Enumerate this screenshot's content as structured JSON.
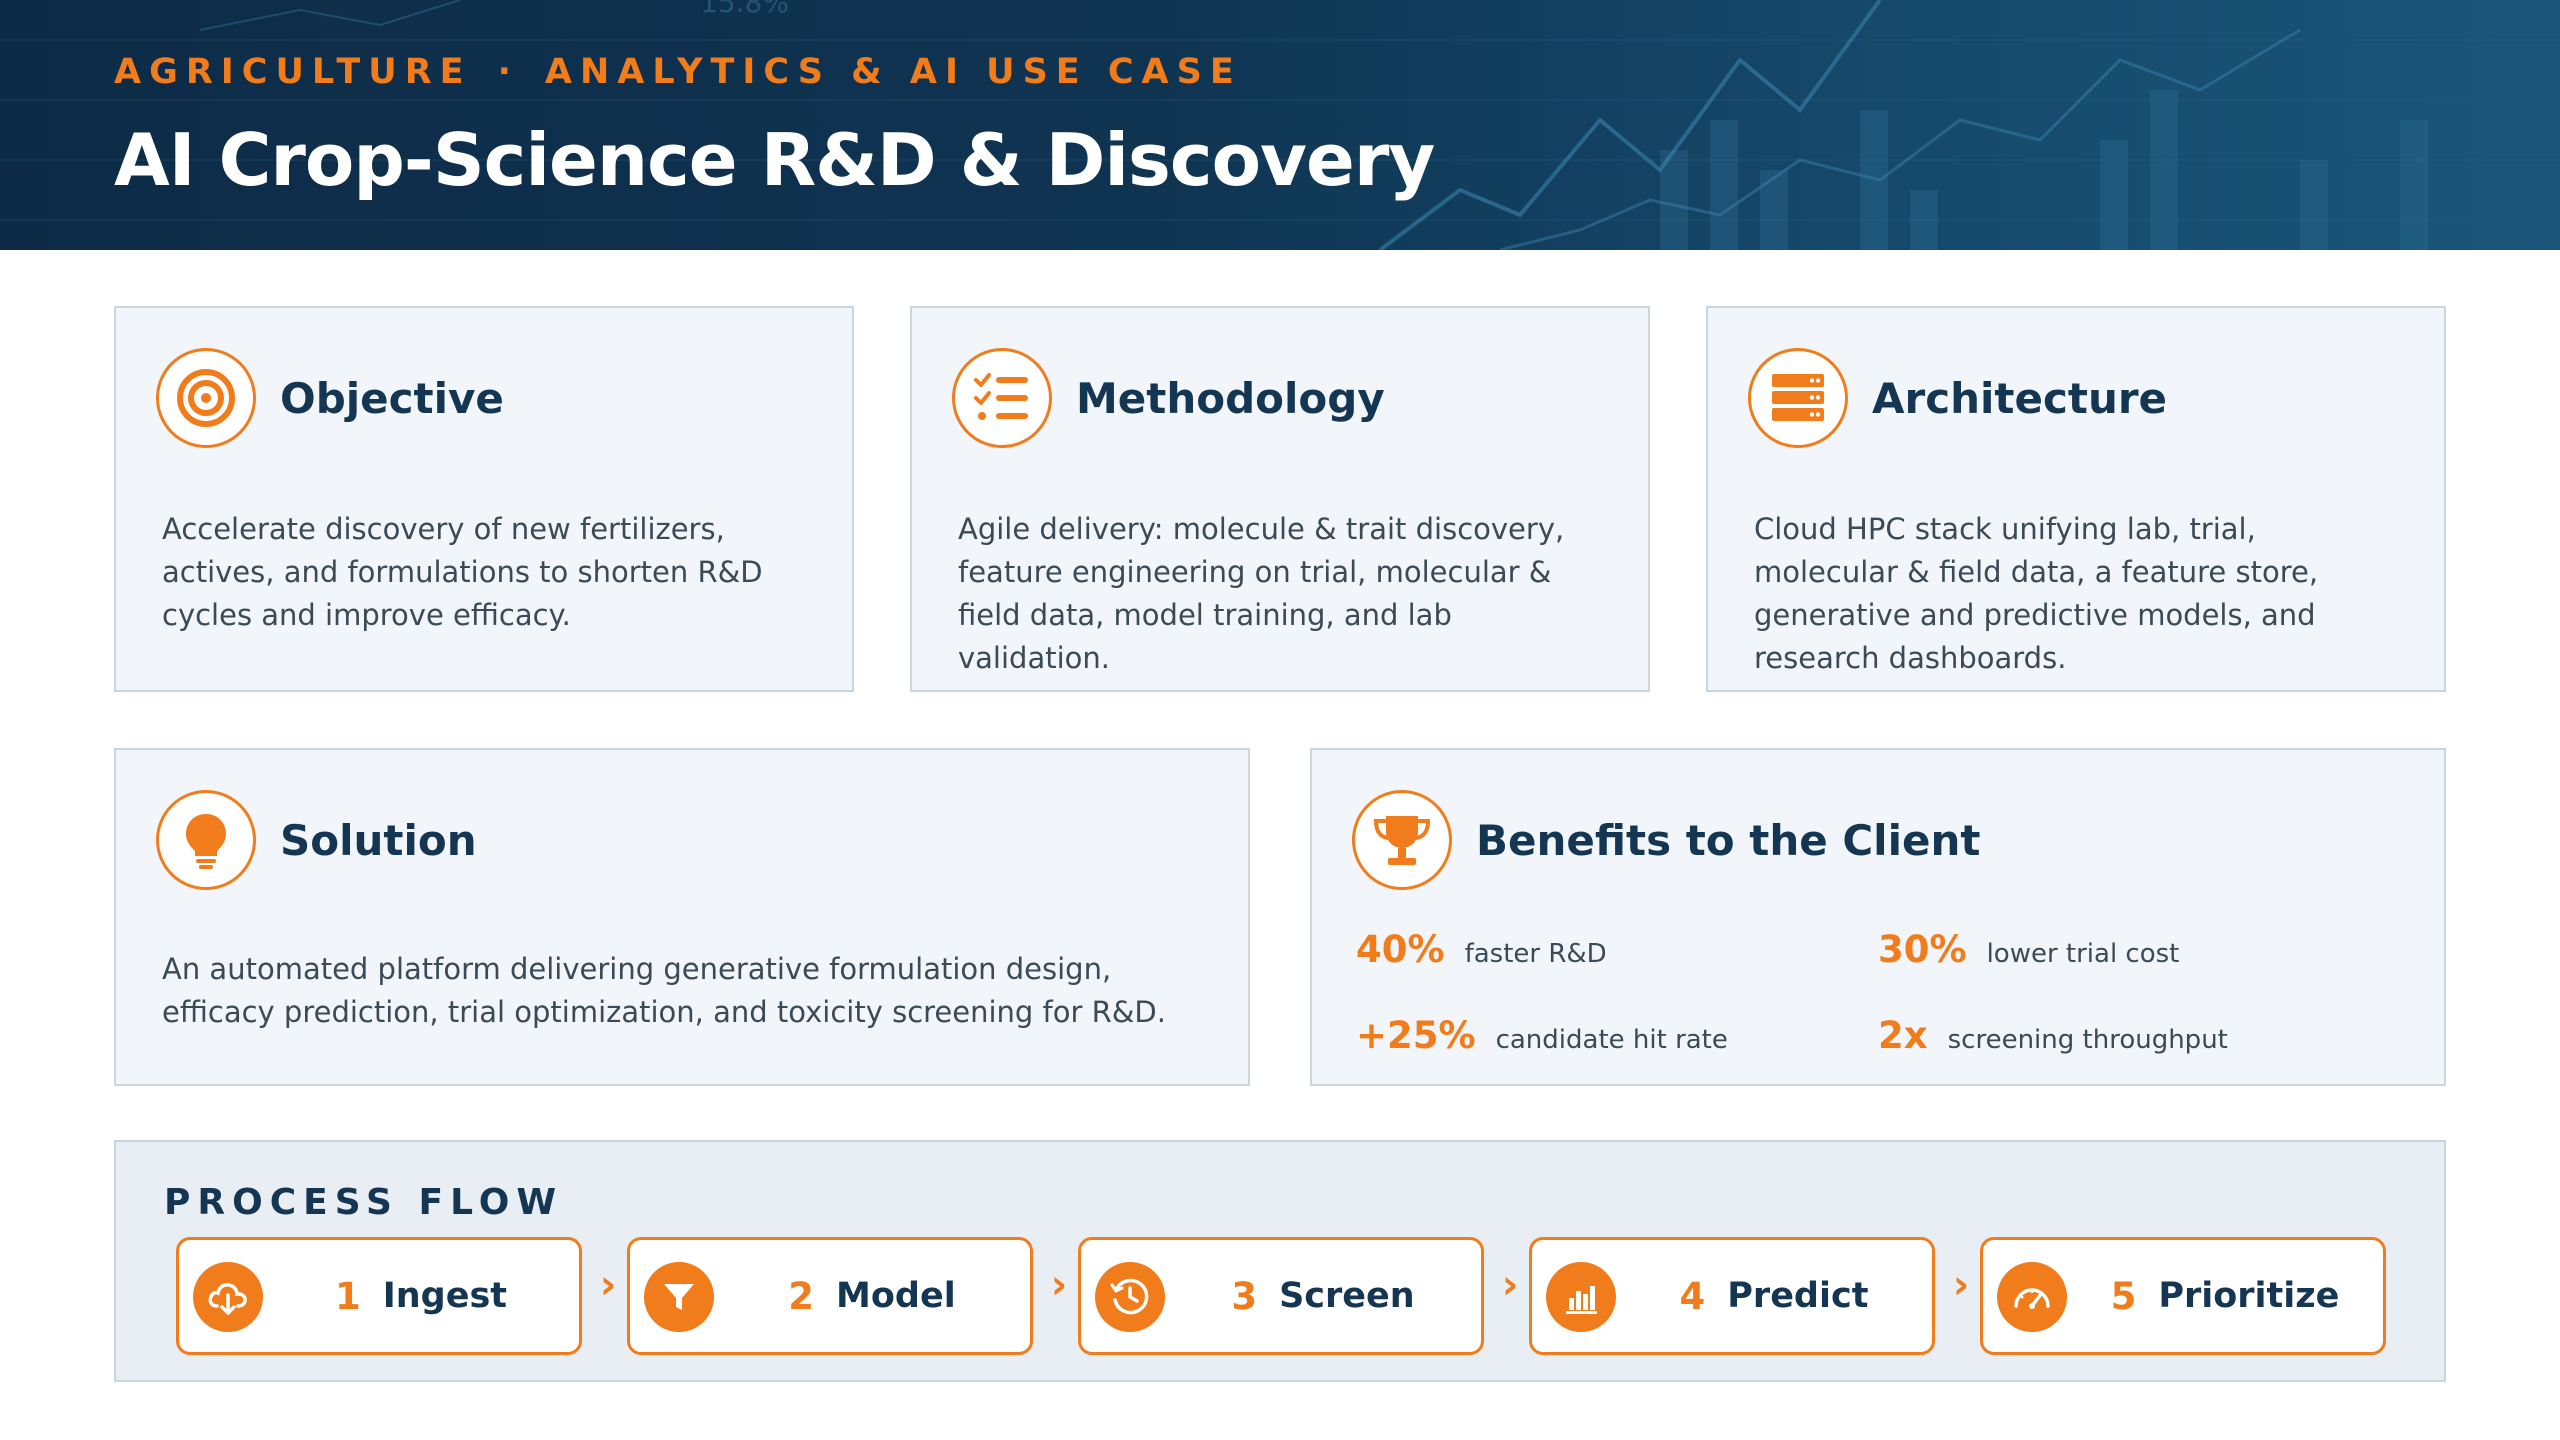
{
  "header": {
    "eyebrow_left": "AGRICULTURE",
    "eyebrow_sep": "·",
    "eyebrow_right": "ANALYTICS & AI USE CASE",
    "title": "AI Crop-Science R&D & Discovery",
    "bg_text": "15.8%"
  },
  "colors": {
    "accent": "#f07c1c",
    "navy": "#143652",
    "header_bg": "#0f3452",
    "card_bg": "#f2f5f9",
    "card_border": "#c9d6e2"
  },
  "cards": {
    "objective": {
      "icon": "target-icon",
      "title": "Objective",
      "body": "Accelerate discovery of new fertilizers, actives, and formulations to shorten R&D cycles and improve efficacy."
    },
    "methodology": {
      "icon": "checklist-icon",
      "title": "Methodology",
      "body": "Agile delivery: molecule & trait discovery, feature engineering on trial, molecular & field data, model training, and lab validation."
    },
    "architecture": {
      "icon": "server-icon",
      "title": "Architecture",
      "body": "Cloud HPC stack unifying lab, trial, molecular & field data, a feature store, generative and predictive models, and research dashboards."
    },
    "solution": {
      "icon": "lightbulb-icon",
      "title": "Solution",
      "body": "An automated platform delivering generative formulation design, efficacy prediction, trial optimization, and toxicity screening for R&D."
    },
    "benefits": {
      "icon": "trophy-icon",
      "title": "Benefits to the Client",
      "items": [
        {
          "value": "40%",
          "label": "faster R&D"
        },
        {
          "value": "30%",
          "label": "lower trial cost"
        },
        {
          "value": "+25%",
          "label": "candidate hit rate"
        },
        {
          "value": "2x",
          "label": "screening throughput"
        }
      ]
    }
  },
  "process": {
    "title": "PROCESS FLOW",
    "chevron": "›",
    "steps": [
      {
        "num": "1",
        "name": "Ingest",
        "icon": "cloud-download-icon"
      },
      {
        "num": "2",
        "name": "Model",
        "icon": "filter-icon"
      },
      {
        "num": "3",
        "name": "Screen",
        "icon": "clock-icon"
      },
      {
        "num": "4",
        "name": "Predict",
        "icon": "bar-chart-icon"
      },
      {
        "num": "5",
        "name": "Prioritize",
        "icon": "speedometer-icon"
      }
    ]
  }
}
